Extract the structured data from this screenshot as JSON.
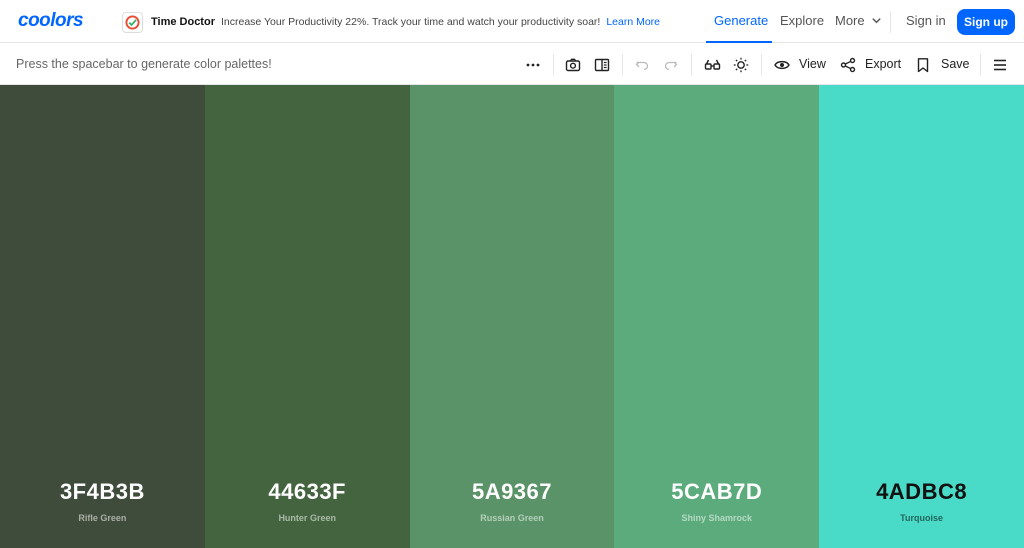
{
  "brand": {
    "logo": "coolors",
    "accent": "#0066ff"
  },
  "ad": {
    "brand": "Time Doctor",
    "text": "Increase Your Productivity 22%. Track your time and watch your productivity soar!",
    "link": "Learn More"
  },
  "nav": {
    "generate": "Generate",
    "explore": "Explore",
    "more": "More",
    "signin": "Sign in",
    "signup": "Sign up"
  },
  "toolbar": {
    "hint": "Press the spacebar to generate color palettes!",
    "view": "View",
    "export": "Export",
    "save": "Save"
  },
  "palette": [
    {
      "hex": "3F4B3B",
      "name": "Rifle Green",
      "color": "#3F4B3B",
      "text": "light"
    },
    {
      "hex": "44633F",
      "name": "Hunter Green",
      "color": "#44633F",
      "text": "light"
    },
    {
      "hex": "5A9367",
      "name": "Russian Green",
      "color": "#5A9367",
      "text": "light"
    },
    {
      "hex": "5CAB7D",
      "name": "Shiny Shamrock",
      "color": "#5CAB7D",
      "text": "light"
    },
    {
      "hex": "4ADBC8",
      "name": "Turquoise",
      "color": "#4ADBC8",
      "text": "dark"
    }
  ]
}
